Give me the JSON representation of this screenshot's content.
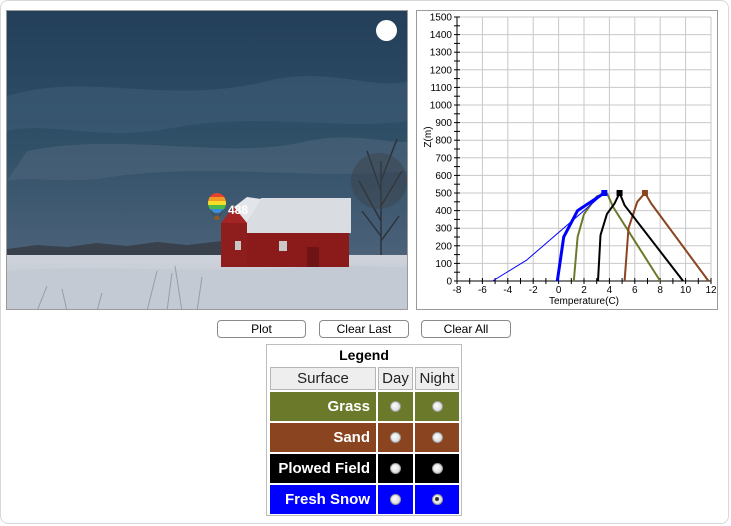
{
  "scene": {
    "balloon_altitude": "488"
  },
  "buttons": {
    "plot": "Plot",
    "clear_last": "Clear Last",
    "clear_all": "Clear All"
  },
  "legend": {
    "title": "Legend",
    "headers": {
      "surface": "Surface",
      "day": "Day",
      "night": "Night"
    },
    "rows": [
      {
        "label": "Grass",
        "color": "#6b7a2a",
        "day_selected": false,
        "night_selected": false
      },
      {
        "label": "Sand",
        "color": "#8b4420",
        "day_selected": false,
        "night_selected": false
      },
      {
        "label": "Plowed Field",
        "color": "#000000",
        "day_selected": false,
        "night_selected": false
      },
      {
        "label": "Fresh Snow",
        "color": "#0000ff",
        "day_selected": false,
        "night_selected": true
      }
    ]
  },
  "chart_data": {
    "type": "line",
    "ylabel": "Z(m)",
    "xlabel": "Temperature(C)",
    "xlim": [
      -8,
      12
    ],
    "ylim": [
      0,
      1500
    ],
    "x_ticks": [
      "-8",
      "-6",
      "-4",
      "-2",
      "0",
      "2",
      "4",
      "6",
      "8",
      "10",
      "12"
    ],
    "y_ticks": [
      "0",
      "100",
      "200",
      "300",
      "400",
      "500",
      "600",
      "700",
      "800",
      "900",
      "1000",
      "1100",
      "1200",
      "1300",
      "1400",
      "1500"
    ],
    "grid": true,
    "series": [
      {
        "color": "#6b7a2a",
        "marker_top": false,
        "points": [
          [
            3.8,
            500
          ],
          [
            4.3,
            420
          ],
          [
            8,
            0
          ]
        ]
      },
      {
        "color": "#6b7a2a",
        "marker_top": false,
        "points": [
          [
            3.8,
            500
          ],
          [
            3,
            480
          ],
          [
            2,
            380
          ],
          [
            1.5,
            250
          ],
          [
            1.2,
            0
          ]
        ]
      },
      {
        "color": "#8b4420",
        "marker_top": true,
        "points": [
          [
            6.8,
            500
          ],
          [
            7.3,
            440
          ],
          [
            11.8,
            0
          ]
        ]
      },
      {
        "color": "#8b4420",
        "marker_top": false,
        "points": [
          [
            6.8,
            500
          ],
          [
            6.2,
            450
          ],
          [
            5.5,
            300
          ],
          [
            5.2,
            0
          ]
        ]
      },
      {
        "color": "#000000",
        "marker_top": true,
        "points": [
          [
            4.8,
            500
          ],
          [
            5.2,
            430
          ],
          [
            9.8,
            0
          ]
        ]
      },
      {
        "color": "#000000",
        "marker_top": false,
        "points": [
          [
            4.8,
            500
          ],
          [
            4.4,
            440
          ],
          [
            3.8,
            380
          ],
          [
            3.3,
            260
          ],
          [
            3.1,
            0
          ]
        ]
      },
      {
        "color": "#0000ff",
        "marker_top": true,
        "width": 3,
        "points": [
          [
            3.6,
            500
          ],
          [
            1.5,
            400
          ],
          [
            0.4,
            250
          ],
          [
            0.1,
            100
          ],
          [
            -0.1,
            0
          ]
        ]
      },
      {
        "color": "#0000ff",
        "marker_top": false,
        "width": 1,
        "points": [
          [
            3.6,
            500
          ],
          [
            2,
            400
          ],
          [
            -2.5,
            120
          ],
          [
            -5.2,
            0
          ]
        ]
      }
    ]
  }
}
